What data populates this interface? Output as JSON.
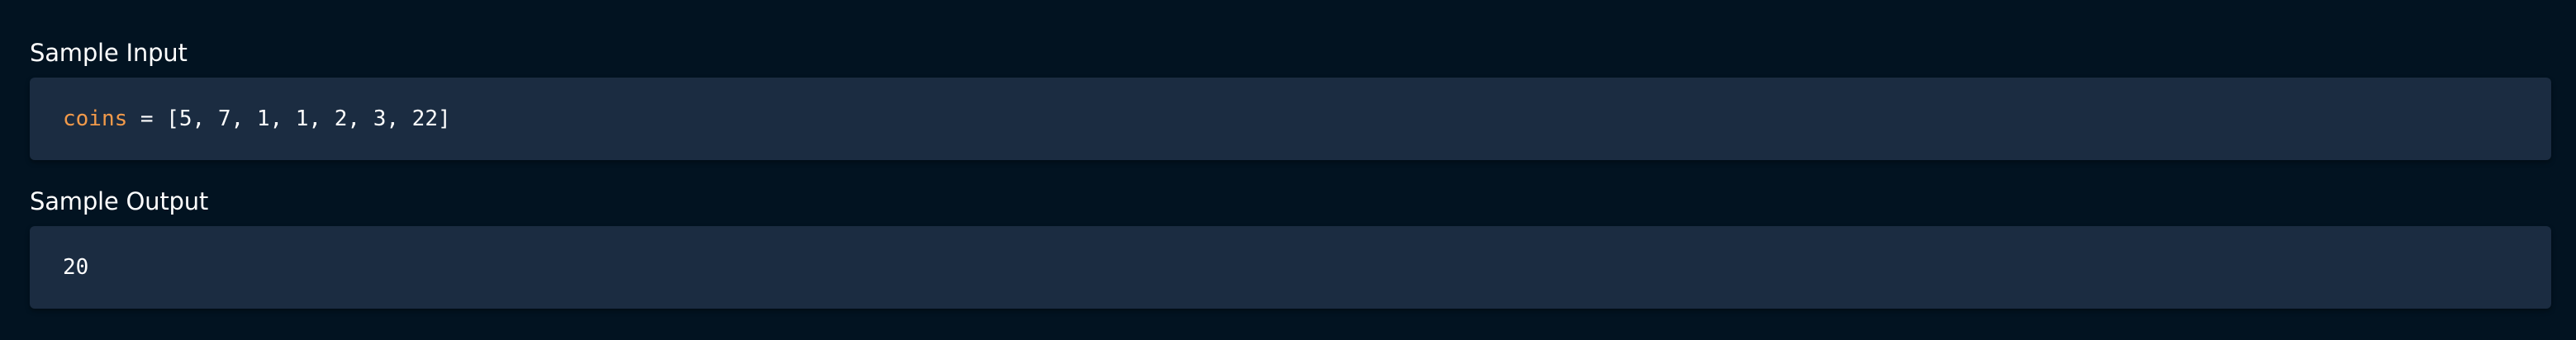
{
  "sample_input": {
    "heading": "Sample Input",
    "variable": "coins",
    "operator": " = ",
    "value": "[5, 7, 1, 1, 2, 3, 22]"
  },
  "sample_output": {
    "heading": "Sample Output",
    "value": "20"
  },
  "colors": {
    "background": "#021321",
    "code_box": "#1b2c41",
    "variable": "#f29a4a",
    "text": "#ffffff"
  }
}
